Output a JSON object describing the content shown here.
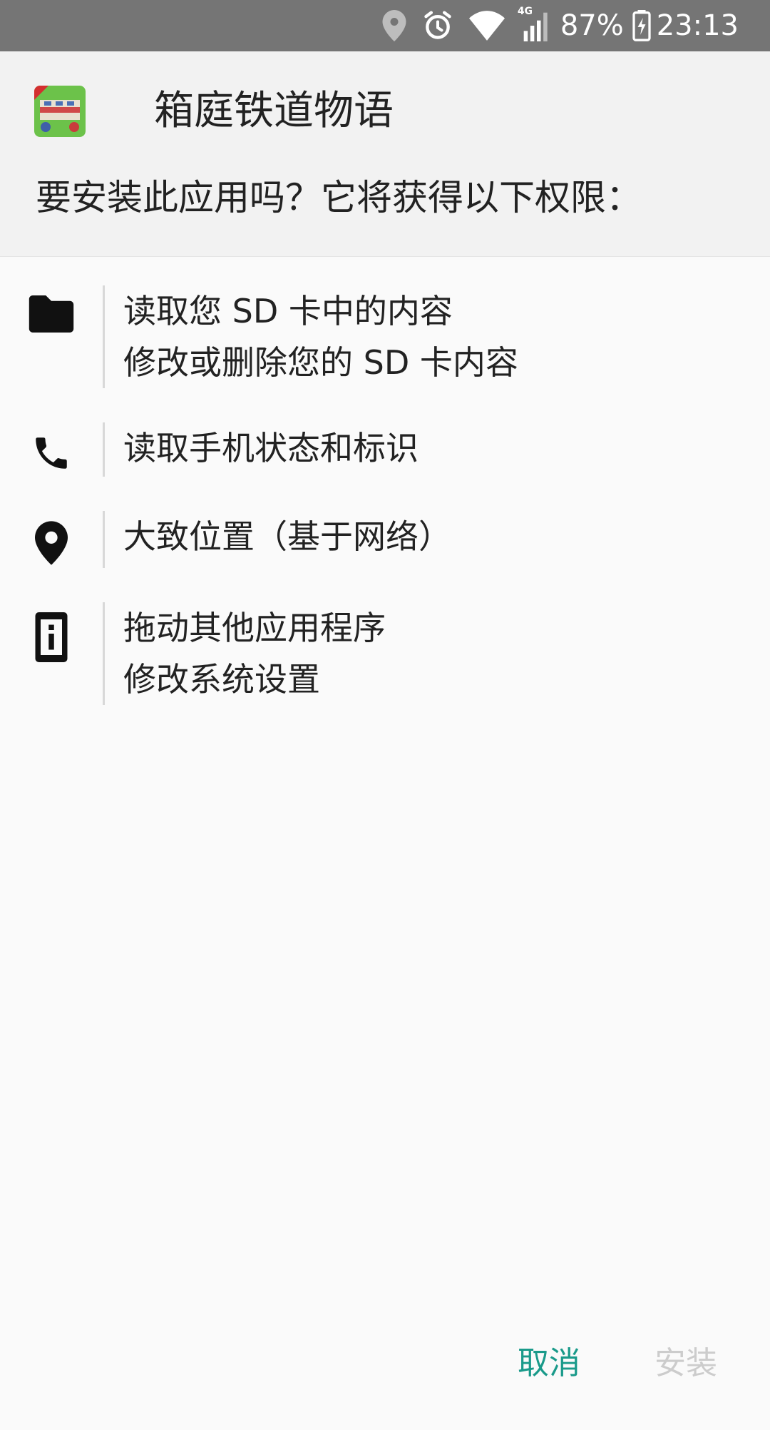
{
  "status_bar": {
    "network": "4G",
    "battery": "87%",
    "time": "23:13",
    "icons": [
      "location-icon",
      "alarm-icon",
      "wifi-icon",
      "signal-icon",
      "battery-charging-icon"
    ]
  },
  "header": {
    "app_name": "箱庭铁道物语",
    "app_icon": "app-icon",
    "prompt": "要安装此应用吗？它将获得以下权限："
  },
  "permissions": [
    {
      "icon": "folder-icon",
      "items": [
        "读取您 SD 卡中的内容",
        "修改或删除您的 SD 卡内容"
      ]
    },
    {
      "icon": "phone-icon",
      "items": [
        "读取手机状态和标识"
      ]
    },
    {
      "icon": "location-pin-icon",
      "items": [
        "大致位置（基于网络）"
      ]
    },
    {
      "icon": "device-info-icon",
      "items": [
        "拖动其他应用程序",
        "修改系统设置"
      ]
    }
  ],
  "actions": {
    "cancel_label": "取消",
    "install_label": "安装"
  },
  "colors": {
    "status_bar": "#757575",
    "accent": "#1a9a8a",
    "disabled": "#cccccc",
    "header_bg": "#f2f2f2",
    "body_bg": "#fafafa"
  }
}
